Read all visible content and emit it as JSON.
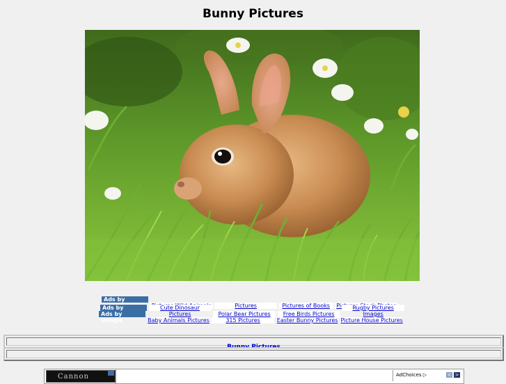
{
  "page": {
    "title": "Bunny Pictures"
  },
  "photo": {
    "alt": "Bunny Pictures"
  },
  "ads": {
    "badge_label": "Ads by Google",
    "rows": [
      [
        "Pictures Wild Animals",
        "Pictures",
        "Pictures of Books",
        "Pictures Stock Photos"
      ],
      [
        "Cute Dinosaur Pictures",
        "Polar Bear Pictures",
        "Free Birds Pictures",
        "Rugby Pictures Images"
      ],
      [
        "Baby Animals Pictures",
        "315 Pictures",
        "Easter Bunny Pictures",
        "Picture House Pictures"
      ]
    ]
  },
  "bar": {
    "link": "Bunny Pictures"
  },
  "bottom_ad": {
    "thumb_text": "Cannon",
    "adchoices": "AdChoices",
    "prev": "<",
    "next": ">"
  },
  "colors": {
    "badge": "#3b6ea5",
    "link": "#0000cc",
    "background": "#f0f0f0"
  }
}
